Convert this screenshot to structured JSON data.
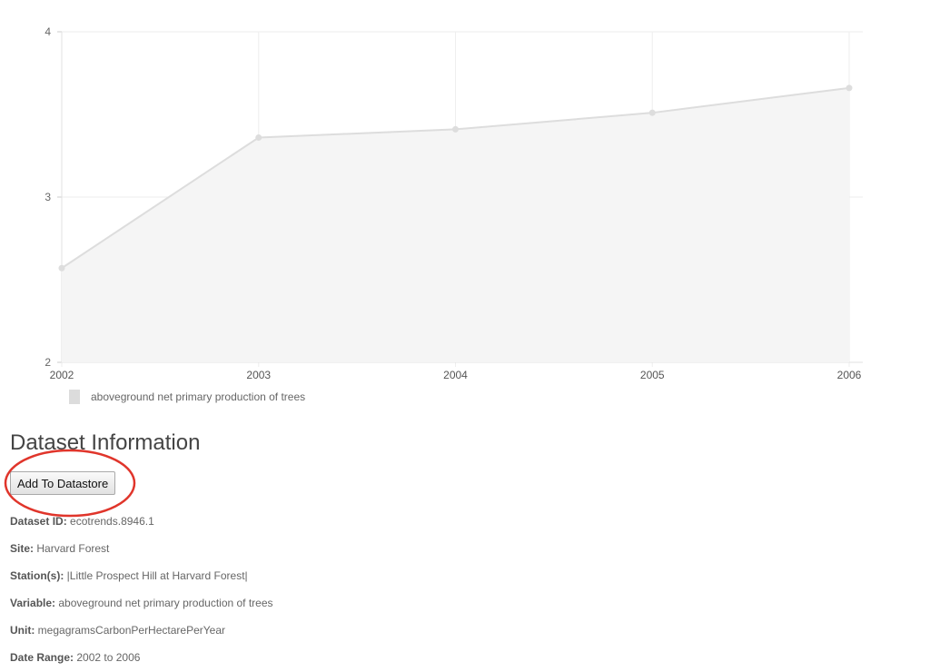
{
  "chart_data": {
    "type": "area",
    "x": [
      "2002",
      "2003",
      "2004",
      "2005",
      "2006"
    ],
    "series": [
      {
        "name": "aboveground net primary production of trees",
        "values": [
          2.57,
          3.36,
          3.41,
          3.51,
          3.66
        ]
      }
    ],
    "ylim": [
      2,
      4
    ],
    "yticks": [
      "2",
      "3",
      "4"
    ],
    "grid": true,
    "legend_position": "bottom-left",
    "colors": {
      "line": "#dddddd",
      "fill": "#f5f5f5",
      "grid": "#eeeeee",
      "legend_swatch": "#dcdcdc"
    }
  },
  "dataset": {
    "heading": "Dataset Information",
    "add_button": "Add To Datastore",
    "fields": [
      {
        "label": "Dataset ID:",
        "value": "ecotrends.8946.1"
      },
      {
        "label": "Site:",
        "value": "Harvard Forest"
      },
      {
        "label": "Station(s):",
        "value": "|Little Prospect Hill at Harvard Forest|"
      },
      {
        "label": "Variable:",
        "value": "aboveground net primary production of trees"
      },
      {
        "label": "Unit:",
        "value": "megagramsCarbonPerHectarePerYear"
      },
      {
        "label": "Date Range:",
        "value": "2002 to 2006"
      }
    ]
  },
  "annotation": {
    "ring_color": "#e0352b"
  }
}
